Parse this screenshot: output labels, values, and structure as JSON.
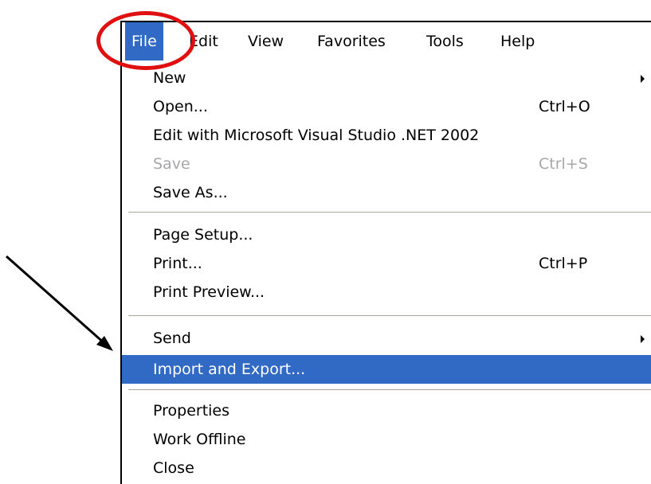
{
  "menubar": {
    "items": [
      {
        "label": "File"
      },
      {
        "label": "Edit"
      },
      {
        "label": "View"
      },
      {
        "label": "Favorites"
      },
      {
        "label": "Tools"
      },
      {
        "label": "Help"
      }
    ]
  },
  "file_menu": {
    "items": [
      {
        "label": "New",
        "shortcut": "",
        "submenu": true,
        "icon": "submenu-arrow-icon"
      },
      {
        "label": "Open...",
        "shortcut": "Ctrl+O"
      },
      {
        "label": "Edit with Microsoft Visual Studio .NET 2002",
        "shortcut": ""
      },
      {
        "label": "Save",
        "shortcut": "Ctrl+S",
        "disabled": true
      },
      {
        "label": "Save As...",
        "shortcut": ""
      },
      {
        "label": "Page Setup...",
        "shortcut": ""
      },
      {
        "label": "Print...",
        "shortcut": "Ctrl+P"
      },
      {
        "label": "Print Preview...",
        "shortcut": ""
      },
      {
        "label": "Send",
        "shortcut": "",
        "submenu": true,
        "icon": "submenu-arrow-icon"
      },
      {
        "label": "Import and Export...",
        "shortcut": "",
        "highlighted": true
      },
      {
        "label": "Properties",
        "shortcut": ""
      },
      {
        "label": "Work Offline",
        "shortcut": ""
      },
      {
        "label": "Close",
        "shortcut": ""
      }
    ]
  },
  "colors": {
    "highlight": "#316ac5",
    "highlight_text": "#ffffff",
    "disabled_text": "#a7a6aa",
    "annotation_red": "#e01010",
    "separator": "#aca899"
  },
  "annotations": {
    "circle_target": "File",
    "arrow_target": "Import and Export..."
  }
}
